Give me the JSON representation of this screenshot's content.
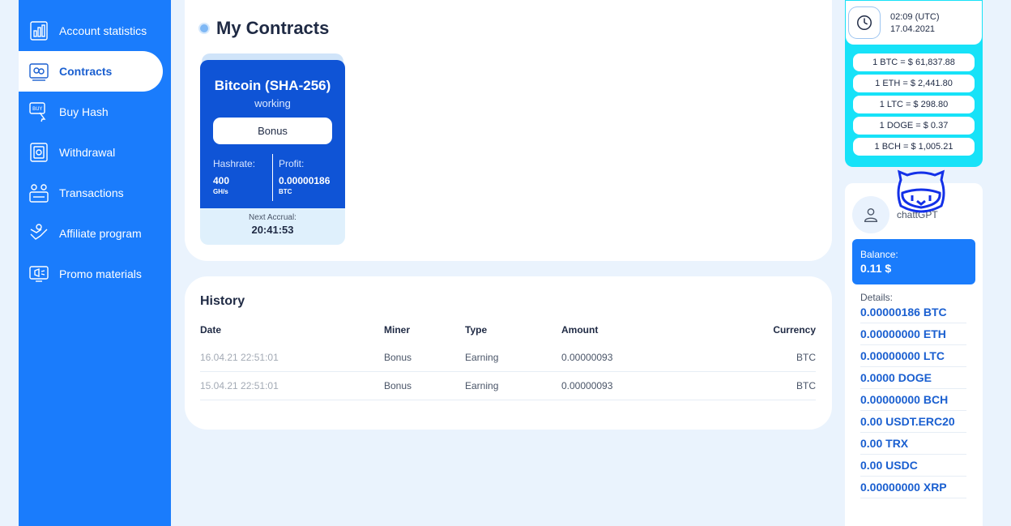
{
  "sidebar": {
    "items": [
      {
        "label": "Account statistics",
        "icon": "stats-icon",
        "active": false
      },
      {
        "label": "Contracts",
        "icon": "contracts-icon",
        "active": true
      },
      {
        "label": "Buy Hash",
        "icon": "buy-icon",
        "active": false
      },
      {
        "label": "Withdrawal",
        "icon": "withdrawal-icon",
        "active": false
      },
      {
        "label": "Transactions",
        "icon": "transactions-icon",
        "active": false
      },
      {
        "label": "Affiliate program",
        "icon": "affiliate-icon",
        "active": false
      },
      {
        "label": "Promo materials",
        "icon": "promo-icon",
        "active": false
      }
    ]
  },
  "contracts": {
    "title": "My Contracts",
    "miner": {
      "name": "Bitcoin (SHA-256)",
      "status": "working",
      "bonus_label": "Bonus",
      "hashrate_label": "Hashrate:",
      "hashrate_value": "400",
      "hashrate_unit": "GH/s",
      "profit_label": "Profit:",
      "profit_value": "0.00000186",
      "profit_unit": "BTC",
      "accrual_label": "Next Accrual:",
      "accrual_value": "20:41:53"
    }
  },
  "history": {
    "title": "History",
    "columns": [
      "Date",
      "Miner",
      "Type",
      "Amount",
      "Currency"
    ],
    "rows": [
      [
        "16.04.21 22:51:01",
        "Bonus",
        "Earning",
        "0.00000093",
        "BTC"
      ],
      [
        "15.04.21 22:51:01",
        "Bonus",
        "Earning",
        "0.00000093",
        "BTC"
      ]
    ]
  },
  "clock": {
    "time": "02:09 (UTC)",
    "date": "17.04.2021"
  },
  "rates": [
    "1 BTC = $ 61,837.88",
    "1 ETH = $ 2,441.80",
    "1 LTC = $ 298.80",
    "1 DOGE = $ 0.37",
    "1 BCH = $ 1,005.21"
  ],
  "account": {
    "username": "chattGPT",
    "balance_label": "Balance:",
    "balance_value": "0.11 $",
    "details_label": "Details:",
    "details": [
      "0.00000186 BTC",
      "0.00000000 ETH",
      "0.00000000 LTC",
      "0.0000 DOGE",
      "0.00000000 BCH",
      "0.00 USDT.ERC20",
      "0.00 TRX",
      "0.00 USDC",
      "0.00000000 XRP"
    ]
  },
  "colors": {
    "sidebar": "#1a7cfc",
    "miner_card": "#0f54d6",
    "rates_panel": "#17e2f8",
    "detail_text": "#1a5fd0"
  }
}
